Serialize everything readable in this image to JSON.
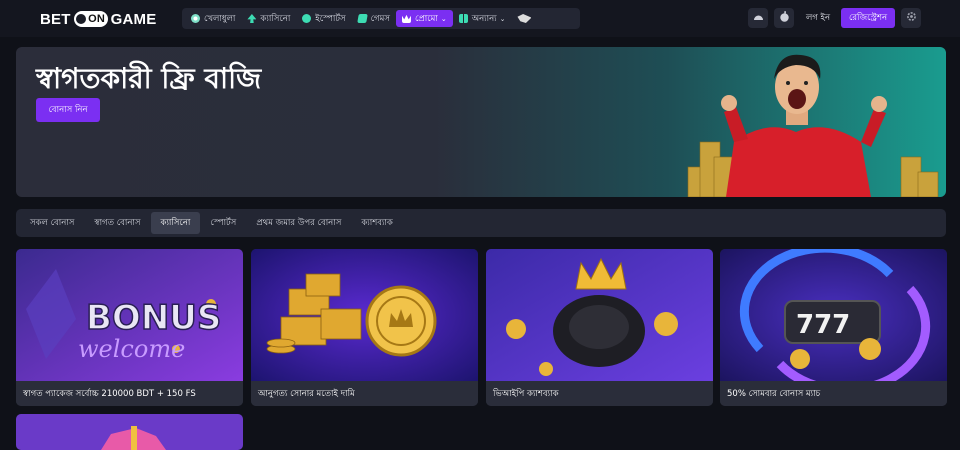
{
  "header": {
    "logo": {
      "part1": "BET",
      "part2": "ON",
      "part3": "GAME"
    },
    "nav": [
      {
        "label": "খেলাধুলা",
        "icon": "soccer-ball-icon",
        "active": false,
        "dropdown": false
      },
      {
        "label": "ক্যাসিনো",
        "icon": "club-icon",
        "active": false,
        "dropdown": false
      },
      {
        "label": "ইস্পোর্টস",
        "icon": "gamepad-icon",
        "active": false,
        "dropdown": false
      },
      {
        "label": "গেমস",
        "icon": "cards-icon",
        "active": false,
        "dropdown": false
      },
      {
        "label": "প্রোমো",
        "icon": "crown-icon",
        "active": true,
        "dropdown": true
      },
      {
        "label": "অন্যান্য",
        "icon": "grid-icon",
        "active": false,
        "dropdown": true
      },
      {
        "label": "",
        "icon": "ipl-logo-icon",
        "active": false,
        "dropdown": false
      }
    ],
    "android_icon": "android-icon",
    "apple_icon": "apple-icon",
    "login_label": "লগ ইন",
    "register_label": "রেজিস্ট্রেশন",
    "settings_icon": "gear-icon"
  },
  "hero": {
    "title": "স্বাগতকারী ফ্রি বাজি",
    "button_label": "বোনাস নিন"
  },
  "tabs": [
    {
      "label": "সকল বোনাস",
      "active": false
    },
    {
      "label": "স্বাগত বোনাস",
      "active": false
    },
    {
      "label": "ক্যাসিনো",
      "active": true
    },
    {
      "label": "স্পোর্টস",
      "active": false
    },
    {
      "label": "প্রথম জমার উপর বোনাস",
      "active": false
    },
    {
      "label": "ক্যাশব্যাক",
      "active": false
    }
  ],
  "cards": [
    {
      "caption": "স্বাগত প্যাকেজ সর্বোচ্চ 210000 BDT + 150 FS",
      "art_text_1": "BONUS",
      "art_text_2": "welcome"
    },
    {
      "caption": "আনুগত্য সোনার মতোই দামি"
    },
    {
      "caption": "ভিআইপি ক্যাশব্যাক"
    },
    {
      "caption": "50% সোমবার বোনাস ম্যাচ",
      "art_text_1": "777"
    },
    {
      "caption": ""
    }
  ],
  "colors": {
    "accent": "#7b2ff2",
    "background": "#0f1118",
    "surface": "#232633",
    "teal": "#1a9c8f"
  }
}
